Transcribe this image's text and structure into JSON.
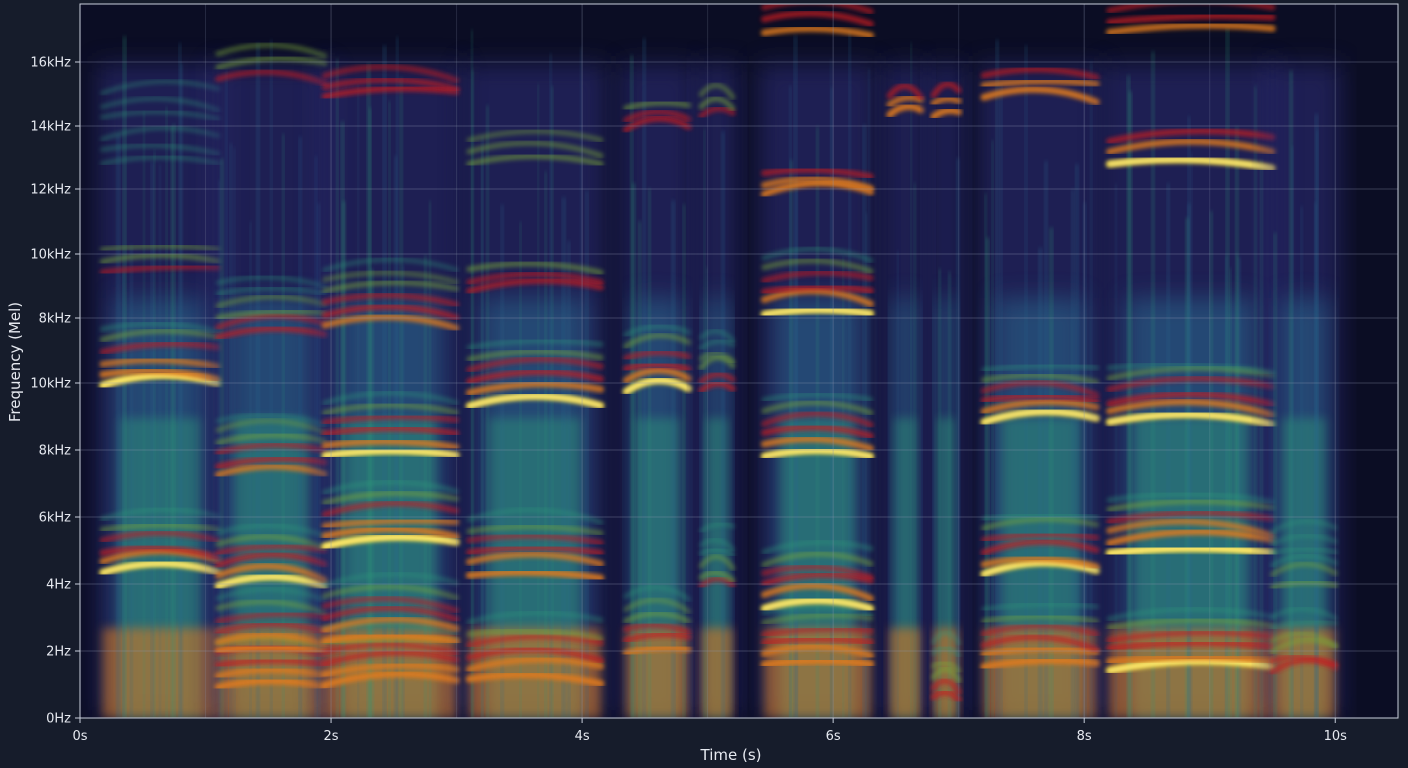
{
  "chart_data": {
    "type": "heatmap",
    "subtype": "mel-spectrogram",
    "xlabel": "Time (s)",
    "ylabel": "Frequency (Mel)",
    "xlim": [
      0,
      10.5
    ],
    "x_ticks": [
      {
        "value": 0,
        "label": "0s"
      },
      {
        "value": 2,
        "label": "2s"
      },
      {
        "value": 4,
        "label": "4s"
      },
      {
        "value": 6,
        "label": "6s"
      },
      {
        "value": 8,
        "label": "8s"
      },
      {
        "value": 10,
        "label": "10s"
      }
    ],
    "y_ticks": [
      "0Hz",
      "2Hz",
      "4Hz",
      "6kHz",
      "8kHz",
      "10kHz",
      "8kHz",
      "10kHz",
      "12kHz",
      "14kHz",
      "16kHz"
    ],
    "grid": true,
    "colormap": [
      "#0b0d24",
      "#2e2f7a",
      "#2b6b8f",
      "#2f9a7a",
      "#7aa838",
      "#e07a1e",
      "#c41f20",
      "#ffe23a",
      "#fff3a8"
    ],
    "background_color": "#0b0d24",
    "segments": [
      {
        "start": 0.18,
        "end": 1.1,
        "harmonics": [
          [
            2.2,
            0.95
          ],
          [
            5.1,
            1.0
          ],
          [
            6.8,
            0.6
          ],
          [
            8.5,
            0.35
          ],
          [
            9.2,
            0.3
          ]
        ]
      },
      {
        "start": 1.1,
        "end": 1.95,
        "harmonics": [
          [
            0.5,
            0.9
          ],
          [
            1.0,
            0.9
          ],
          [
            2.0,
            0.95
          ],
          [
            3.7,
            0.8
          ],
          [
            5.8,
            0.7
          ],
          [
            9.8,
            0.6
          ]
        ]
      },
      {
        "start": 1.95,
        "end": 3.0,
        "harmonics": [
          [
            0.5,
            0.9
          ],
          [
            1.2,
            0.9
          ],
          [
            2.6,
            1.0
          ],
          [
            4.0,
            0.95
          ],
          [
            6.0,
            0.8
          ],
          [
            9.5,
            0.75
          ],
          [
            12.5,
            0.35
          ]
        ]
      },
      {
        "start": 3.1,
        "end": 4.15,
        "harmonics": [
          [
            0.6,
            0.9
          ],
          [
            2.2,
            0.9
          ],
          [
            4.8,
            0.95
          ],
          [
            6.5,
            0.7
          ],
          [
            8.5,
            0.55
          ]
        ]
      },
      {
        "start": 4.35,
        "end": 4.85,
        "harmonics": [
          [
            1.0,
            0.8
          ],
          [
            5.0,
            0.95
          ],
          [
            9.0,
            0.7
          ]
        ]
      },
      {
        "start": 4.95,
        "end": 5.2,
        "harmonics": [
          [
            2.0,
            0.6
          ],
          [
            5.0,
            0.7
          ],
          [
            9.2,
            0.6
          ]
        ]
      },
      {
        "start": 5.45,
        "end": 6.3,
        "harmonics": [
          [
            0.8,
            0.9
          ],
          [
            1.7,
            0.95
          ],
          [
            4.0,
            0.95
          ],
          [
            6.2,
            0.95
          ],
          [
            8.0,
            0.9
          ],
          [
            10.5,
            0.85
          ]
        ]
      },
      {
        "start": 6.45,
        "end": 6.7,
        "harmonics": [
          [
            9.2,
            0.9
          ]
        ]
      },
      {
        "start": 6.8,
        "end": 7.0,
        "harmonics": [
          [
            9.2,
            0.9
          ],
          [
            0.3,
            0.7
          ]
        ]
      },
      {
        "start": 7.2,
        "end": 8.1,
        "harmonics": [
          [
            0.8,
            0.9
          ],
          [
            2.2,
            0.95
          ],
          [
            4.5,
            0.95
          ],
          [
            9.5,
            0.9
          ],
          [
            11.0,
            0.75
          ]
        ]
      },
      {
        "start": 8.2,
        "end": 9.5,
        "harmonics": [
          [
            0.7,
            0.95
          ],
          [
            2.5,
            1.0
          ],
          [
            4.5,
            0.95
          ],
          [
            8.5,
            0.95
          ],
          [
            10.5,
            0.85
          ],
          [
            12.0,
            0.75
          ]
        ]
      },
      {
        "start": 9.5,
        "end": 10.0,
        "harmonics": [
          [
            0.7,
            0.65
          ],
          [
            2.0,
            0.5
          ]
        ]
      }
    ]
  }
}
